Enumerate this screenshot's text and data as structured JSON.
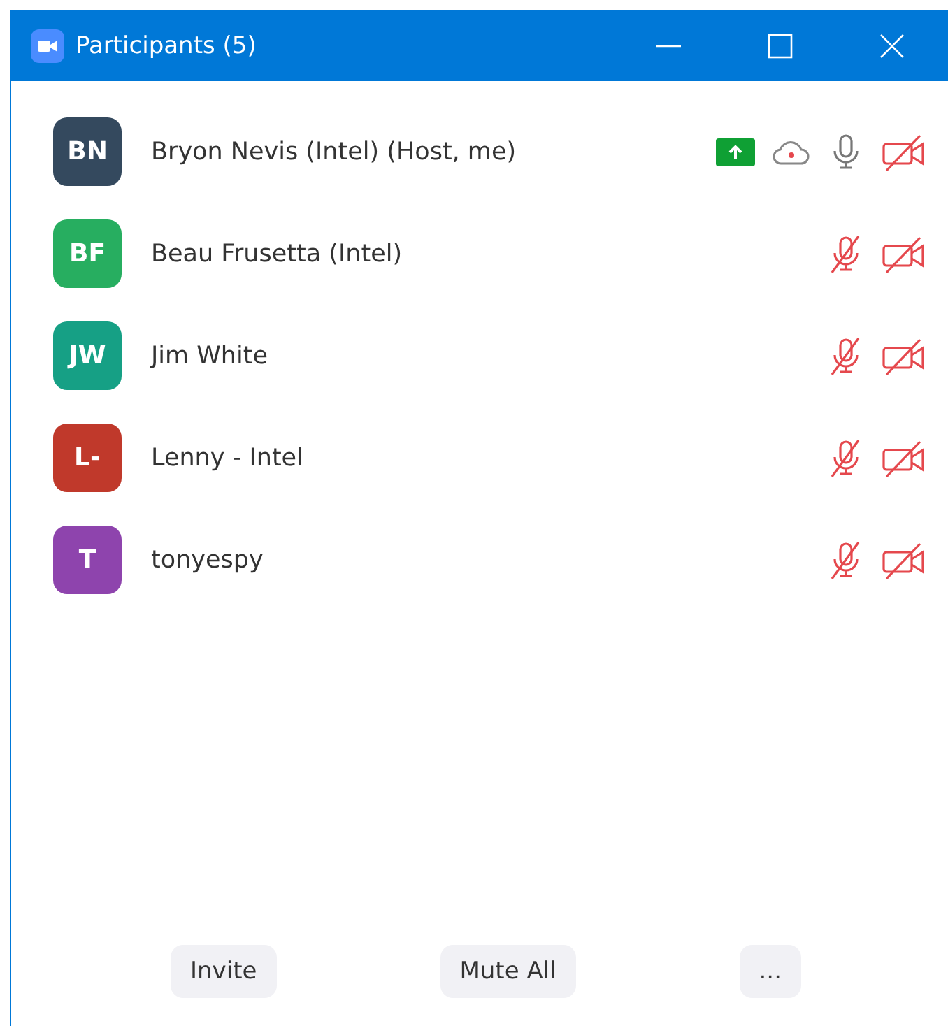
{
  "window": {
    "title": "Participants (5)"
  },
  "participants": [
    {
      "initials": "BN",
      "color": "#34495e",
      "name": "Bryon Nevis (Intel) (Host, me)",
      "sharing": true,
      "recording": true,
      "muted": false,
      "video_on": false
    },
    {
      "initials": "BF",
      "color": "#27ae60",
      "name": "Beau Frusetta (Intel)",
      "sharing": false,
      "recording": false,
      "muted": true,
      "video_on": false
    },
    {
      "initials": "JW",
      "color": "#16a085",
      "name": "Jim White",
      "sharing": false,
      "recording": false,
      "muted": true,
      "video_on": false
    },
    {
      "initials": "L-",
      "color": "#c0392b",
      "name": "Lenny - Intel",
      "sharing": false,
      "recording": false,
      "muted": true,
      "video_on": false
    },
    {
      "initials": "T",
      "color": "#8e44ad",
      "name": "tonyespy",
      "sharing": false,
      "recording": false,
      "muted": true,
      "video_on": false
    }
  ],
  "buttons": [
    "Invite",
    "Mute All",
    "..."
  ]
}
